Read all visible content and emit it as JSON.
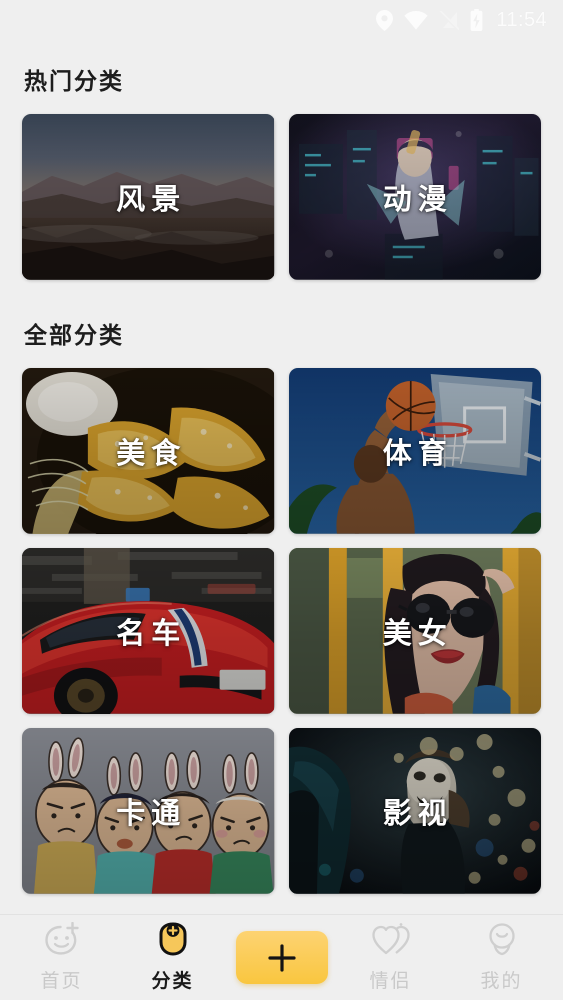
{
  "statusbar": {
    "time": "11:54",
    "icons": [
      {
        "name": "location-icon",
        "dim": false
      },
      {
        "name": "wifi-icon",
        "dim": false
      },
      {
        "name": "signal-off-icon",
        "dim": true
      },
      {
        "name": "battery-charging-icon",
        "dim": false
      }
    ]
  },
  "sections": [
    {
      "title": "热门分类"
    },
    {
      "title": "全部分类"
    }
  ],
  "hot_categories": [
    {
      "label": "风景",
      "art": "landscape-photo"
    },
    {
      "label": "动漫",
      "art": "anime-cyberpunk-art"
    }
  ],
  "all_categories": [
    {
      "label": "美食",
      "art": "fried-food-photo"
    },
    {
      "label": "体育",
      "art": "basketball-dunk-photo"
    },
    {
      "label": "名车",
      "art": "red-sportscar-photo"
    },
    {
      "label": "美女",
      "art": "woman-sunglasses-photo"
    },
    {
      "label": "卡通",
      "art": "cartoon-bunny-characters"
    },
    {
      "label": "影视",
      "art": "night-movie-scene"
    }
  ],
  "navbar": {
    "items": [
      {
        "label": "首页",
        "icon": "smiley-plus-icon",
        "active": false
      },
      {
        "label": "分类",
        "icon": "category-face-plus-icon",
        "active": true
      },
      {
        "label": "情侣",
        "icon": "double-heart-icon",
        "active": false
      },
      {
        "label": "我的",
        "icon": "profile-head-icon",
        "active": false
      }
    ],
    "fab": {
      "icon": "plus-icon",
      "label": "+"
    }
  },
  "colors": {
    "background": "#efefef",
    "accent": "#f9c63f",
    "accent_light": "#fdd372",
    "nav_inactive": "#c9c9c9",
    "nav_active": "#1a1a1a",
    "title": "#1d1d1d"
  }
}
